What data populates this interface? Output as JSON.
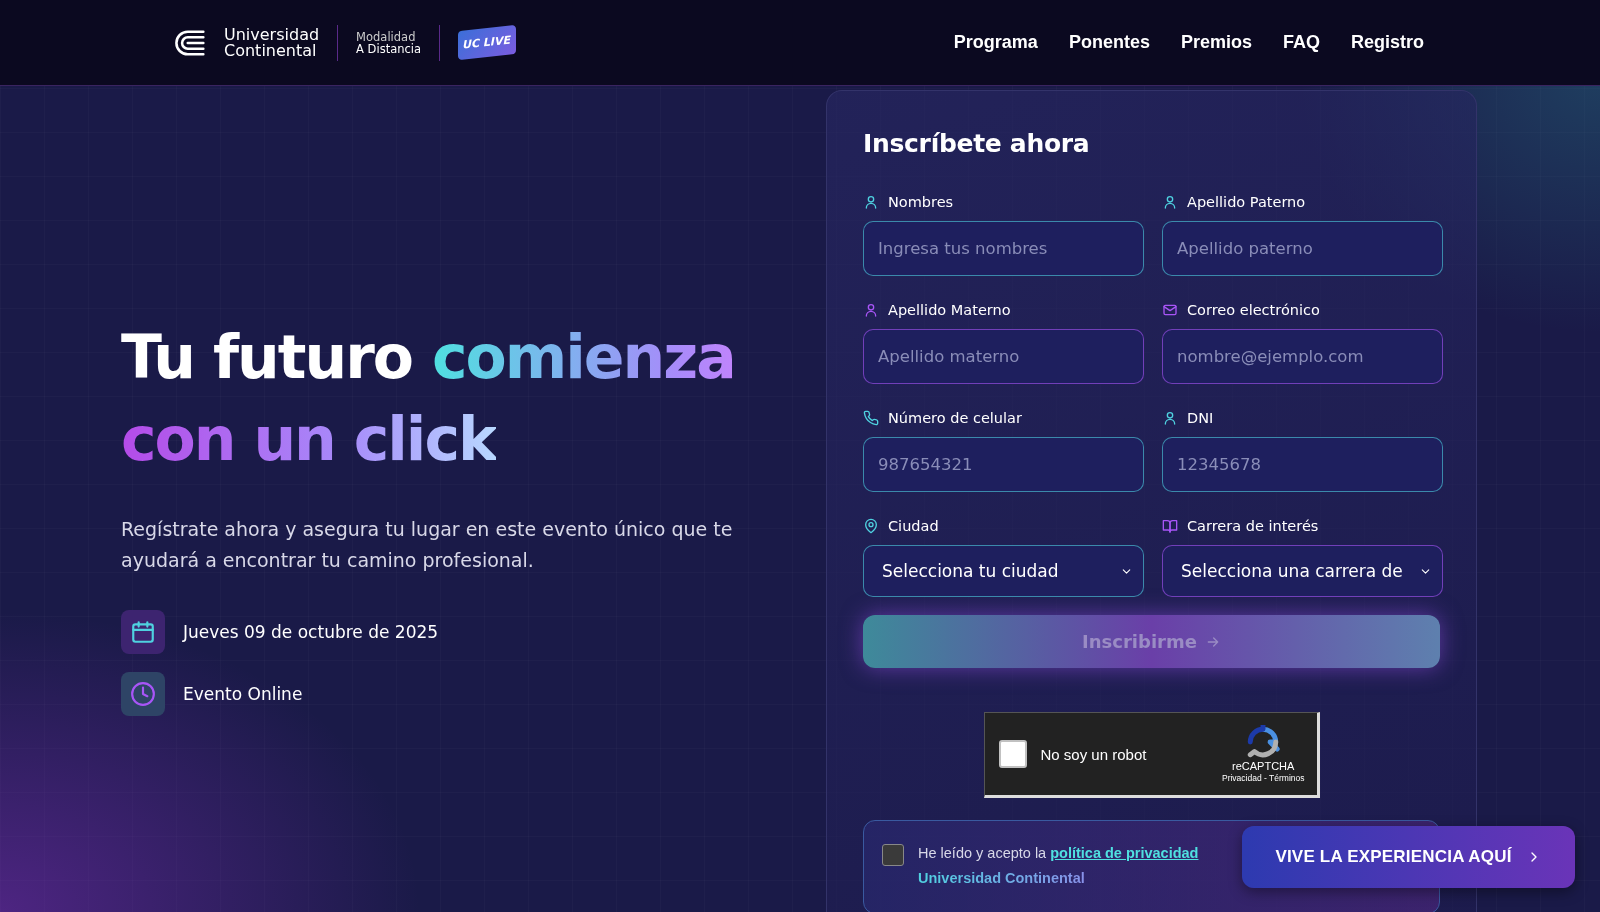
{
  "header": {
    "brand": {
      "line1": "Universidad",
      "line2": "Continental"
    },
    "modality": {
      "line1": "Modalidad",
      "line2": "A Distancia"
    },
    "badge": "UC LIVE",
    "nav": [
      {
        "label": "Programa"
      },
      {
        "label": "Ponentes"
      },
      {
        "label": "Premios"
      },
      {
        "label": "FAQ"
      },
      {
        "label": "Registro"
      }
    ]
  },
  "hero": {
    "headline": [
      [
        "Tu futuro",
        "comienza"
      ],
      [
        "con un click"
      ]
    ],
    "description": "Regístrate ahora y asegura tu lugar en este evento único que te ayudará a encontrar tu camino profesional.",
    "details": [
      "Jueves 09 de octubre de 2025",
      "Evento Online"
    ]
  },
  "form": {
    "title": "Inscríbete ahora",
    "fields": [
      {
        "kind": "input",
        "label": "Nombres",
        "placeholder": "Ingresa tus nombres",
        "color": "#4fd1e0"
      },
      {
        "kind": "input",
        "label": "Apellido Paterno",
        "placeholder": "Apellido paterno",
        "color": "#4fd1e0"
      },
      {
        "kind": "input",
        "label": "Apellido Materno",
        "placeholder": "Apellido materno",
        "color": "#a855f7"
      },
      {
        "kind": "input",
        "label": "Correo electrónico",
        "placeholder": "nombre@ejemplo.com",
        "color": "#a855f7"
      },
      {
        "kind": "input",
        "label": "Número de celular",
        "placeholder": "987654321",
        "color": "#4fd1e0"
      },
      {
        "kind": "input",
        "label": "DNI",
        "placeholder": "12345678",
        "color": "#4fd1e0"
      },
      {
        "kind": "select",
        "label": "Ciudad",
        "value": "Selecciona tu ciudad",
        "color": "#4fd1e0"
      },
      {
        "kind": "select",
        "label": "Carrera de interés",
        "value": "Selecciona una carrera de",
        "color": "#a855f7"
      }
    ],
    "submit": {
      "label": "Inscribirme",
      "disabled": true
    },
    "captcha": {
      "label": "No soy un robot",
      "checked": false,
      "brand": "reCAPTCHA",
      "links": "Privacidad - Términos"
    },
    "consent": {
      "checked": false,
      "text": "He leído y acepto la",
      "link": "política de privacidad",
      "org": "Universidad Continental"
    }
  },
  "floating_button": {
    "label": "VIVE LA EXPERIENCIA AQUÍ"
  }
}
